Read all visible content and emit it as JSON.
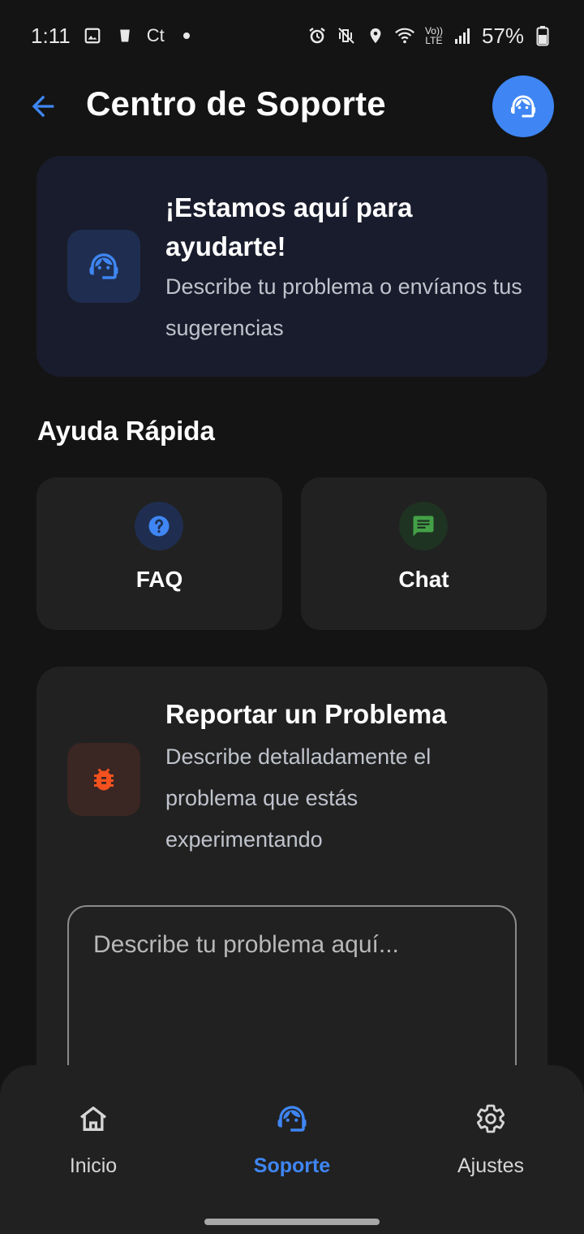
{
  "status_bar": {
    "time": "1:11",
    "battery": "57%",
    "left_icons": [
      "image-icon",
      "cup-icon",
      "ct-icon",
      "dot-icon"
    ],
    "right_icons": [
      "alarm-icon",
      "vibrate-icon",
      "location-icon",
      "wifi-icon",
      "volte-icon",
      "signal-icon",
      "battery-icon"
    ],
    "ct_label": "Ct",
    "volte_label": "Vo)) LTE"
  },
  "header": {
    "title": "Centro de Soporte",
    "accent_color": "#3f86f4"
  },
  "hero": {
    "title": "¡Estamos aquí para ayudarte!",
    "subtitle": "Describe tu problema o envíanos tus sugerencias"
  },
  "quick_help": {
    "section_title": "Ayuda Rápida",
    "items": [
      {
        "label": "FAQ",
        "icon": "help-circle-icon",
        "color": "#3f86f4"
      },
      {
        "label": "Chat",
        "icon": "chat-icon",
        "color": "#43a047"
      }
    ]
  },
  "report": {
    "title": "Reportar un Problema",
    "subtitle": "Describe detalladamente el problema que estás experimentando",
    "input_placeholder": "Describe tu problema aquí...",
    "input_value": "",
    "icon": "bug-icon",
    "icon_color": "#f4511e"
  },
  "bottom_nav": {
    "items": [
      {
        "label": "Inicio",
        "icon": "home-icon",
        "active": false
      },
      {
        "label": "Soporte",
        "icon": "support-agent-icon",
        "active": true
      },
      {
        "label": "Ajustes",
        "icon": "gear-icon",
        "active": false
      }
    ]
  }
}
